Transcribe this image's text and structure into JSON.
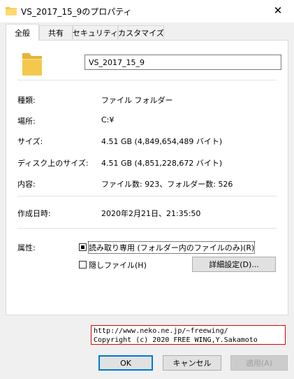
{
  "window": {
    "title": "VS_2017_15_9のプロパティ",
    "close_glyph": "✕"
  },
  "tabs": [
    {
      "label": "全般",
      "active": true
    },
    {
      "label": "共有",
      "active": false
    },
    {
      "label": "セキュリティ",
      "active": false
    },
    {
      "label": "カスタマイズ",
      "active": false
    }
  ],
  "general": {
    "name_value": "VS_2017_15_9",
    "type_label": "種類:",
    "type_value": "ファイル フォルダー",
    "location_label": "場所:",
    "location_value": "C:¥",
    "size_label": "サイズ:",
    "size_value": "4.51 GB (4,849,654,489 バイト)",
    "disk_size_label": "ディスク上のサイズ:",
    "disk_size_value": "4.51 GB (4,851,228,672 バイト)",
    "contents_label": "内容:",
    "contents_value": "ファイル数: 923、フォルダー数: 526",
    "created_label": "作成日時:",
    "created_value": "2020年2月21日、21:35:50",
    "attributes_label": "属性:",
    "readonly_label": "読み取り専用 (フォルダー内のファイルのみ)(R)",
    "hidden_label": "隠しファイル(H)",
    "advanced_button": "詳細設定(D)..."
  },
  "watermark": {
    "line1": "http://www.neko.ne.jp/~freewing/",
    "line2": "Copyright (c) 2020 FREE WING,Y.Sakamoto"
  },
  "buttons": {
    "ok": "OK",
    "cancel": "キャンセル",
    "apply": "適用(A)"
  },
  "colors": {
    "folder": "#f4c84b",
    "accent": "#0078d7",
    "watermark_border": "#e00000"
  },
  "icons": {
    "folder": "folder-icon",
    "close": "close-icon"
  }
}
